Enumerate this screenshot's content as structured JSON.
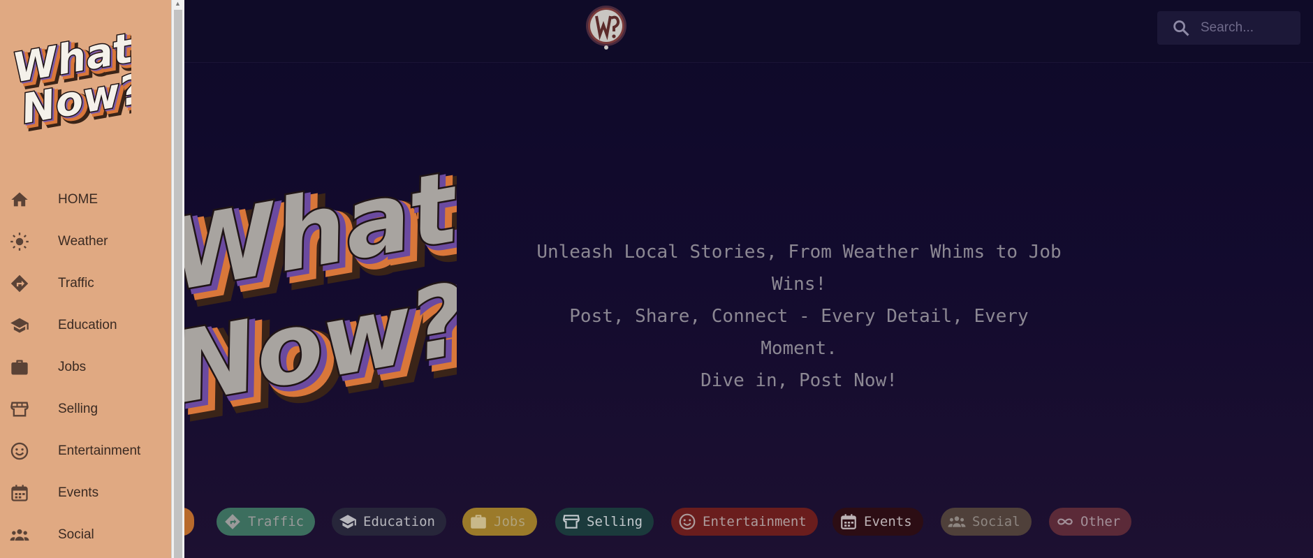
{
  "search": {
    "placeholder": "Search..."
  },
  "tagline": {
    "line1": "Unleash Local Stories, From Weather Whims to Job Wins!",
    "line2": "Post, Share, Connect - Every Detail, Every Moment.",
    "line3": "Dive in, Post Now!"
  },
  "logo": {
    "line1": "What",
    "line2": "Now?",
    "top_mark": "W?"
  },
  "sidebar": {
    "items": [
      {
        "label": "HOME",
        "icon": "home-icon"
      },
      {
        "label": "Weather",
        "icon": "sun-icon"
      },
      {
        "label": "Traffic",
        "icon": "directions-icon"
      },
      {
        "label": "Education",
        "icon": "school-icon"
      },
      {
        "label": "Jobs",
        "icon": "briefcase-icon"
      },
      {
        "label": "Selling",
        "icon": "storefront-icon"
      },
      {
        "label": "Entertainment",
        "icon": "smiley-icon"
      },
      {
        "label": "Events",
        "icon": "calendar-icon"
      },
      {
        "label": "Social",
        "icon": "people-icon"
      }
    ]
  },
  "categories": [
    {
      "label": "Traffic",
      "icon": "directions-icon",
      "bg": "#3c6e5e",
      "fg": "#9a9a9a"
    },
    {
      "label": "Education",
      "icon": "school-icon",
      "bg": "#27263a",
      "fg": "#b6b6bc"
    },
    {
      "label": "Jobs",
      "icon": "briefcase-icon",
      "bg": "#9b7a2a",
      "fg": "#b0a27a"
    },
    {
      "label": "Selling",
      "icon": "storefront-icon",
      "bg": "#1b3a3c",
      "fg": "#c2c8cc"
    },
    {
      "label": "Entertainment",
      "icon": "smiley-icon",
      "bg": "#6a1d1d",
      "fg": "#ad9d9d"
    },
    {
      "label": "Events",
      "icon": "calendar-icon",
      "bg": "#2c0d14",
      "fg": "#bdb3b6"
    },
    {
      "label": "Social",
      "icon": "people-icon",
      "bg": "#4f403a",
      "fg": "#8d8580"
    },
    {
      "label": "Other",
      "icon": "infinity-icon",
      "bg": "#5b2a38",
      "fg": "#a39099"
    }
  ],
  "colors": {
    "sidebar_bg": "#e0a982",
    "main_bg": "#0f0a28",
    "accent_orange": "#d9773a"
  }
}
